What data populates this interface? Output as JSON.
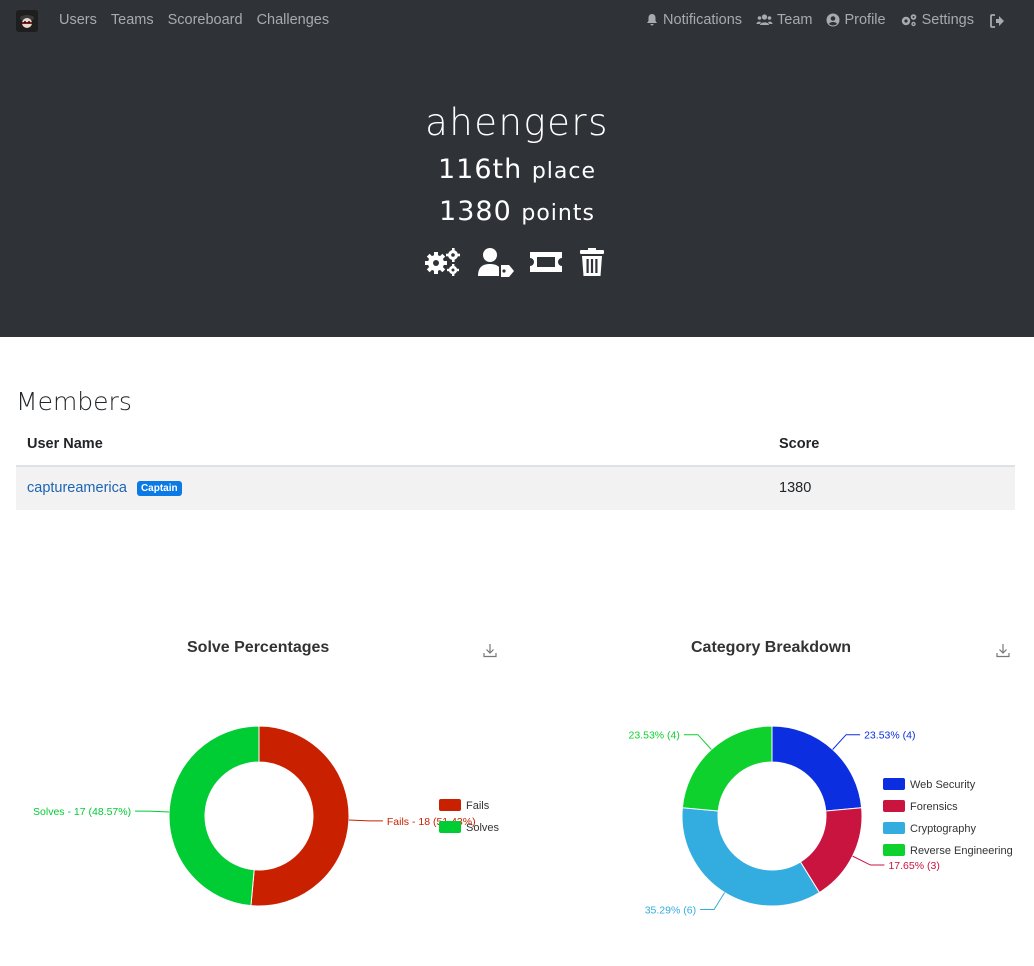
{
  "nav": {
    "left": [
      "Users",
      "Teams",
      "Scoreboard",
      "Challenges"
    ],
    "right": [
      {
        "label": "Notifications",
        "icon": "bell-icon"
      },
      {
        "label": "Team",
        "icon": "users-icon"
      },
      {
        "label": "Profile",
        "icon": "user-circle-icon"
      },
      {
        "label": "Settings",
        "icon": "cogs-icon"
      }
    ]
  },
  "team": {
    "name": "ahengers",
    "place_value": "116th",
    "place_label": "place",
    "points_value": "1380",
    "points_label": "points"
  },
  "members": {
    "title": "Members",
    "headers": [
      "User Name",
      "Score"
    ],
    "rows": [
      {
        "name": "captureamerica",
        "badge": "Captain",
        "score": "1380"
      }
    ]
  },
  "chart_data": [
    {
      "type": "pie",
      "title": "Solve Percentages",
      "categories": [
        "Fails",
        "Solves"
      ],
      "values": [
        18,
        17
      ],
      "labels": [
        "Fails - 18 (51.43%)",
        "Solves - 17 (48.57%)"
      ],
      "colors": [
        "#c92100",
        "#00cc33"
      ],
      "legend": "right"
    },
    {
      "type": "pie",
      "title": "Category Breakdown",
      "categories": [
        "Web Security",
        "Forensics",
        "Cryptography",
        "Reverse Engineering"
      ],
      "values": [
        4,
        3,
        6,
        4
      ],
      "labels": [
        "23.53% (4)",
        "17.65% (3)",
        "35.29% (6)",
        "23.53% (4)"
      ],
      "colors": [
        "#0a2ee0",
        "#c8143f",
        "#33ade0",
        "#0ed12e"
      ],
      "legend": "right"
    }
  ]
}
